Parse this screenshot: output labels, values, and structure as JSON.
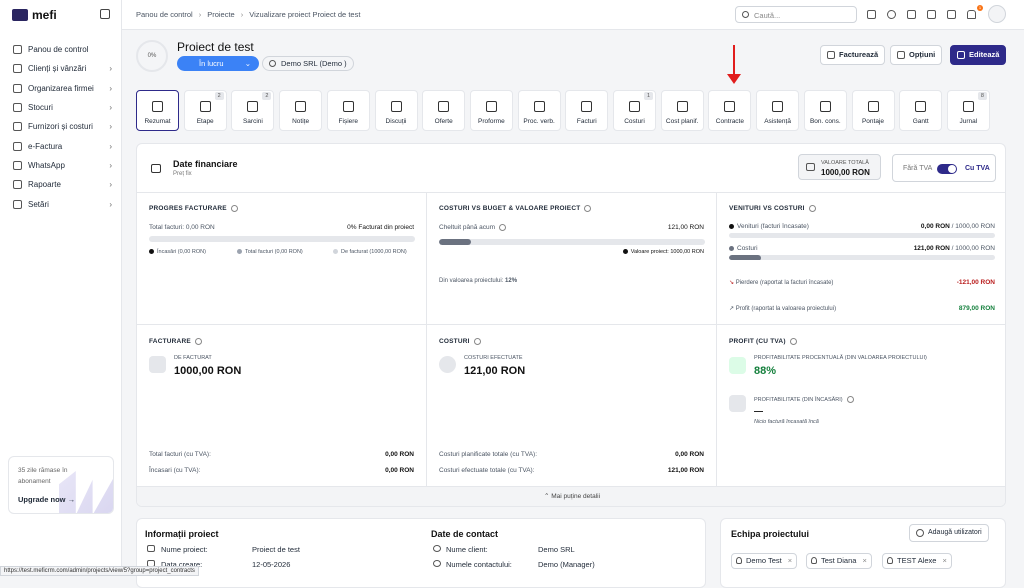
{
  "app": {
    "logo": "mefi"
  },
  "sidebar": {
    "items": [
      {
        "label": "Panou de control",
        "arrow": ""
      },
      {
        "label": "Clienți și vânzări",
        "arrow": "›"
      },
      {
        "label": "Organizarea firmei",
        "arrow": "›"
      },
      {
        "label": "Stocuri",
        "arrow": "›"
      },
      {
        "label": "Furnizori și costuri",
        "arrow": "›"
      },
      {
        "label": "e-Factura",
        "arrow": "›"
      },
      {
        "label": "WhatsApp",
        "arrow": "›"
      },
      {
        "label": "Rapoarte",
        "arrow": "›"
      },
      {
        "label": "Setări",
        "arrow": "›"
      }
    ],
    "trial_text": "35 zile rămase în abonament",
    "upgrade_label": "Upgrade now →"
  },
  "topbar": {
    "breadcrumb": [
      "Panou de control",
      "Proiecte",
      "Vizualizare proiect Proiect de test"
    ],
    "breadcrumb_sep": "›",
    "search_placeholder": "Caută...",
    "notif_count": "1"
  },
  "project": {
    "progress": "0%",
    "title": "Proiect de test",
    "status": "În lucru",
    "status_chevron": "⌄",
    "client": "Demo SRL (Demo )",
    "buttons": {
      "invoice": "Facturează",
      "options": "Opțiuni",
      "edit": "Editează"
    }
  },
  "tabs": [
    {
      "label": "Rezumat",
      "badge": ""
    },
    {
      "label": "Etape",
      "badge": "2"
    },
    {
      "label": "Sarcini",
      "badge": "2"
    },
    {
      "label": "Notițe",
      "badge": ""
    },
    {
      "label": "Fișiere",
      "badge": ""
    },
    {
      "label": "Discuții",
      "badge": ""
    },
    {
      "label": "Oferte",
      "badge": ""
    },
    {
      "label": "Proforme",
      "badge": ""
    },
    {
      "label": "Proc. verb.",
      "badge": ""
    },
    {
      "label": "Facturi",
      "badge": ""
    },
    {
      "label": "Costuri",
      "badge": "1"
    },
    {
      "label": "Cost planif.",
      "badge": ""
    },
    {
      "label": "Contracte",
      "badge": ""
    },
    {
      "label": "Asistență",
      "badge": ""
    },
    {
      "label": "Bon. cons.",
      "badge": ""
    },
    {
      "label": "Pontaje",
      "badge": ""
    },
    {
      "label": "Gantt",
      "badge": ""
    },
    {
      "label": "Jurnal",
      "badge": "8"
    }
  ],
  "financial": {
    "title": "Date financiare",
    "subtitle": "Preț fix",
    "total_value_label": "VALOARE TOTALĂ",
    "total_value": "1000,00 RON",
    "vat_off": "Fără TVA",
    "vat_on": "Cu TVA",
    "billing_progress": {
      "title": "PROGRES FACTURARE",
      "total_label": "Total facturi: 0,00 RON",
      "percent_label": "0% Facturat din proiect",
      "fill": 0,
      "legend": [
        "Încasări (0,00 RON)",
        "Total facturi (0,00 RON)",
        "De facturat (1000,00 RON)"
      ]
    },
    "costs_vs_budget": {
      "title": "COSTURI VS BUGET & VALOARE PROIECT",
      "spent_label": "Cheltuit până acum",
      "spent_value": "121,00 RON",
      "fill": 0.121,
      "legend": "Valoare proiect: 1000,00 RON",
      "share_label": "Din valoarea proiectului:",
      "share_value": "12%"
    },
    "revenue_vs_costs": {
      "title": "VENITURI VS COSTURI",
      "rev_label": "Venituri (facturi încasate)",
      "rev_value": "0,00 RON",
      "rev_total": "/ 1000,00 RON",
      "rev_fill": 0,
      "cost_label": "Costuri",
      "cost_value": "121,00 RON",
      "cost_total": "/ 1000,00 RON",
      "cost_fill": 0.121,
      "loss_label": "Pierdere (raportat la facturi încasate)",
      "loss_value": "-121,00 RON",
      "profit_label": "Profit (raportat la valoarea proiectului)",
      "profit_value": "879,00 RON"
    },
    "invoicing": {
      "title": "FACTURARE",
      "sub": "DE FACTURAT",
      "value": "1000,00 RON",
      "total_label": "Total facturi (cu TVA):",
      "total_value": "0,00 RON",
      "collected_label": "Încasari (cu TVA):",
      "collected_value": "0,00 RON"
    },
    "costs": {
      "title": "COSTURI",
      "sub": "COSTURI EFECTUATE",
      "value": "121,00 RON",
      "planned_label": "Costuri planificate totale (cu TVA):",
      "planned_value": "0,00 RON",
      "done_label": "Costuri efectuate totale (cu TVA):",
      "done_value": "121,00 RON"
    },
    "profit": {
      "title": "PROFIT (CU TVA)",
      "pct_label": "PROFITABILITATE PROCENTUALĂ (DIN VALOAREA PROIECTULUI)",
      "pct_value": "88%",
      "cash_label": "PROFITABILITATE (DIN ÎNCASĂRI)",
      "cash_value": "—",
      "cash_note": "Nicio factură încasată încă"
    },
    "more_label": "⌃  Mai puține detalii"
  },
  "info": {
    "title": "Informații proiect",
    "rows": [
      {
        "label": "Nume proiect:",
        "value": "Proiect de test"
      },
      {
        "label": "Data creare:",
        "value": "12-05-2026"
      }
    ]
  },
  "contact": {
    "title": "Date de contact",
    "rows": [
      {
        "label": "Nume client:",
        "value": "Demo SRL"
      },
      {
        "label": "Numele contactului:",
        "value": "Demo (Manager)"
      }
    ]
  },
  "team": {
    "title": "Echipa proiectului",
    "add_label": "Adaugă utilizatori",
    "members": [
      "Demo Test",
      "Test Diana",
      "TEST Alexe"
    ],
    "remove": "×"
  },
  "status_url": "https://test.meficrm.com/admin/projects/view/5?group=project_contracts"
}
